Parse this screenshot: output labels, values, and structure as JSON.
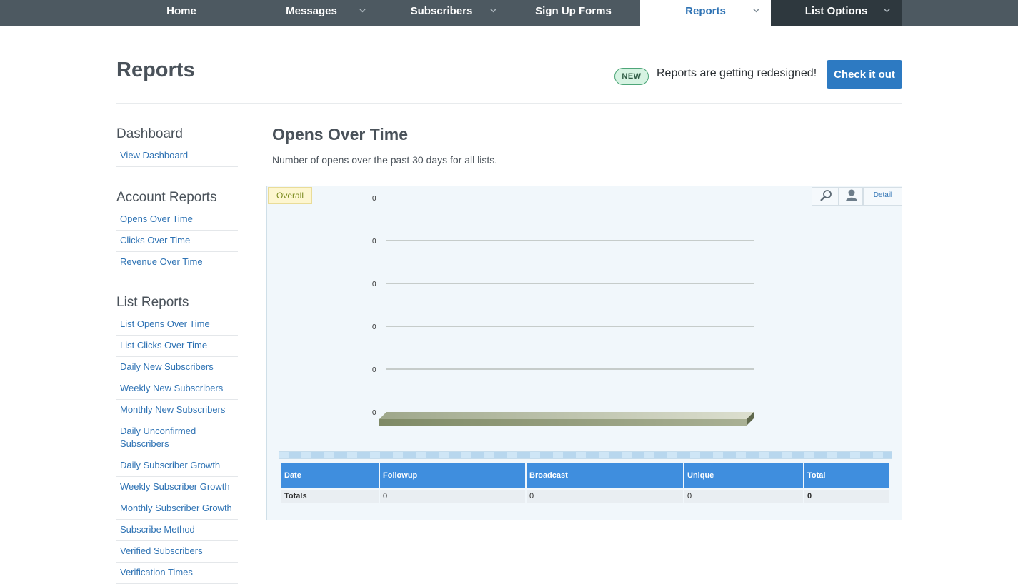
{
  "nav": {
    "items": [
      {
        "label": "Home"
      },
      {
        "label": "Messages"
      },
      {
        "label": "Subscribers"
      },
      {
        "label": "Sign Up Forms"
      },
      {
        "label": "Reports"
      },
      {
        "label": "List Options"
      }
    ],
    "active": "Reports"
  },
  "header": {
    "title": "Reports",
    "badge": "NEW",
    "announcement": "Reports are getting redesigned!",
    "cta": "Check it out"
  },
  "sidebar": {
    "sections": [
      {
        "heading": "Dashboard",
        "items": [
          "View Dashboard"
        ]
      },
      {
        "heading": "Account Reports",
        "items": [
          "Opens Over Time",
          "Clicks Over Time",
          "Revenue Over Time"
        ]
      },
      {
        "heading": "List Reports",
        "items": [
          "List Opens Over Time",
          "List Clicks Over Time",
          "Daily New Subscribers",
          "Weekly New Subscribers",
          "Monthly New Subscribers",
          "Daily Unconfirmed Subscribers",
          "Daily Subscriber Growth",
          "Weekly Subscriber Growth",
          "Monthly Subscriber Growth",
          "Subscribe Method",
          "Verified Subscribers",
          "Verification Times"
        ]
      }
    ]
  },
  "main": {
    "title": "Opens Over Time",
    "description": "Number of opens over the past 30 days for all lists.",
    "tab": "Overall",
    "detail_label": "Detail",
    "tools": [
      "magnifier-icon",
      "user-icon"
    ]
  },
  "chart_data": {
    "type": "bar",
    "categories": [],
    "series": [],
    "y_tick_labels": [
      "0",
      "0",
      "0",
      "0",
      "0",
      "0"
    ],
    "grid": true
  },
  "table": {
    "headers": [
      "Date",
      "Followup",
      "Broadcast",
      "Unique",
      "Total"
    ],
    "rows": [
      [
        "Totals",
        "0",
        "0",
        "0",
        "0"
      ]
    ]
  },
  "colors": {
    "nav_bg": "#4d5961",
    "nav_dark": "#2e383e",
    "accent": "#2d7ac2",
    "badge_bg": "#d6f3e2",
    "table_header": "#3f8ede"
  }
}
